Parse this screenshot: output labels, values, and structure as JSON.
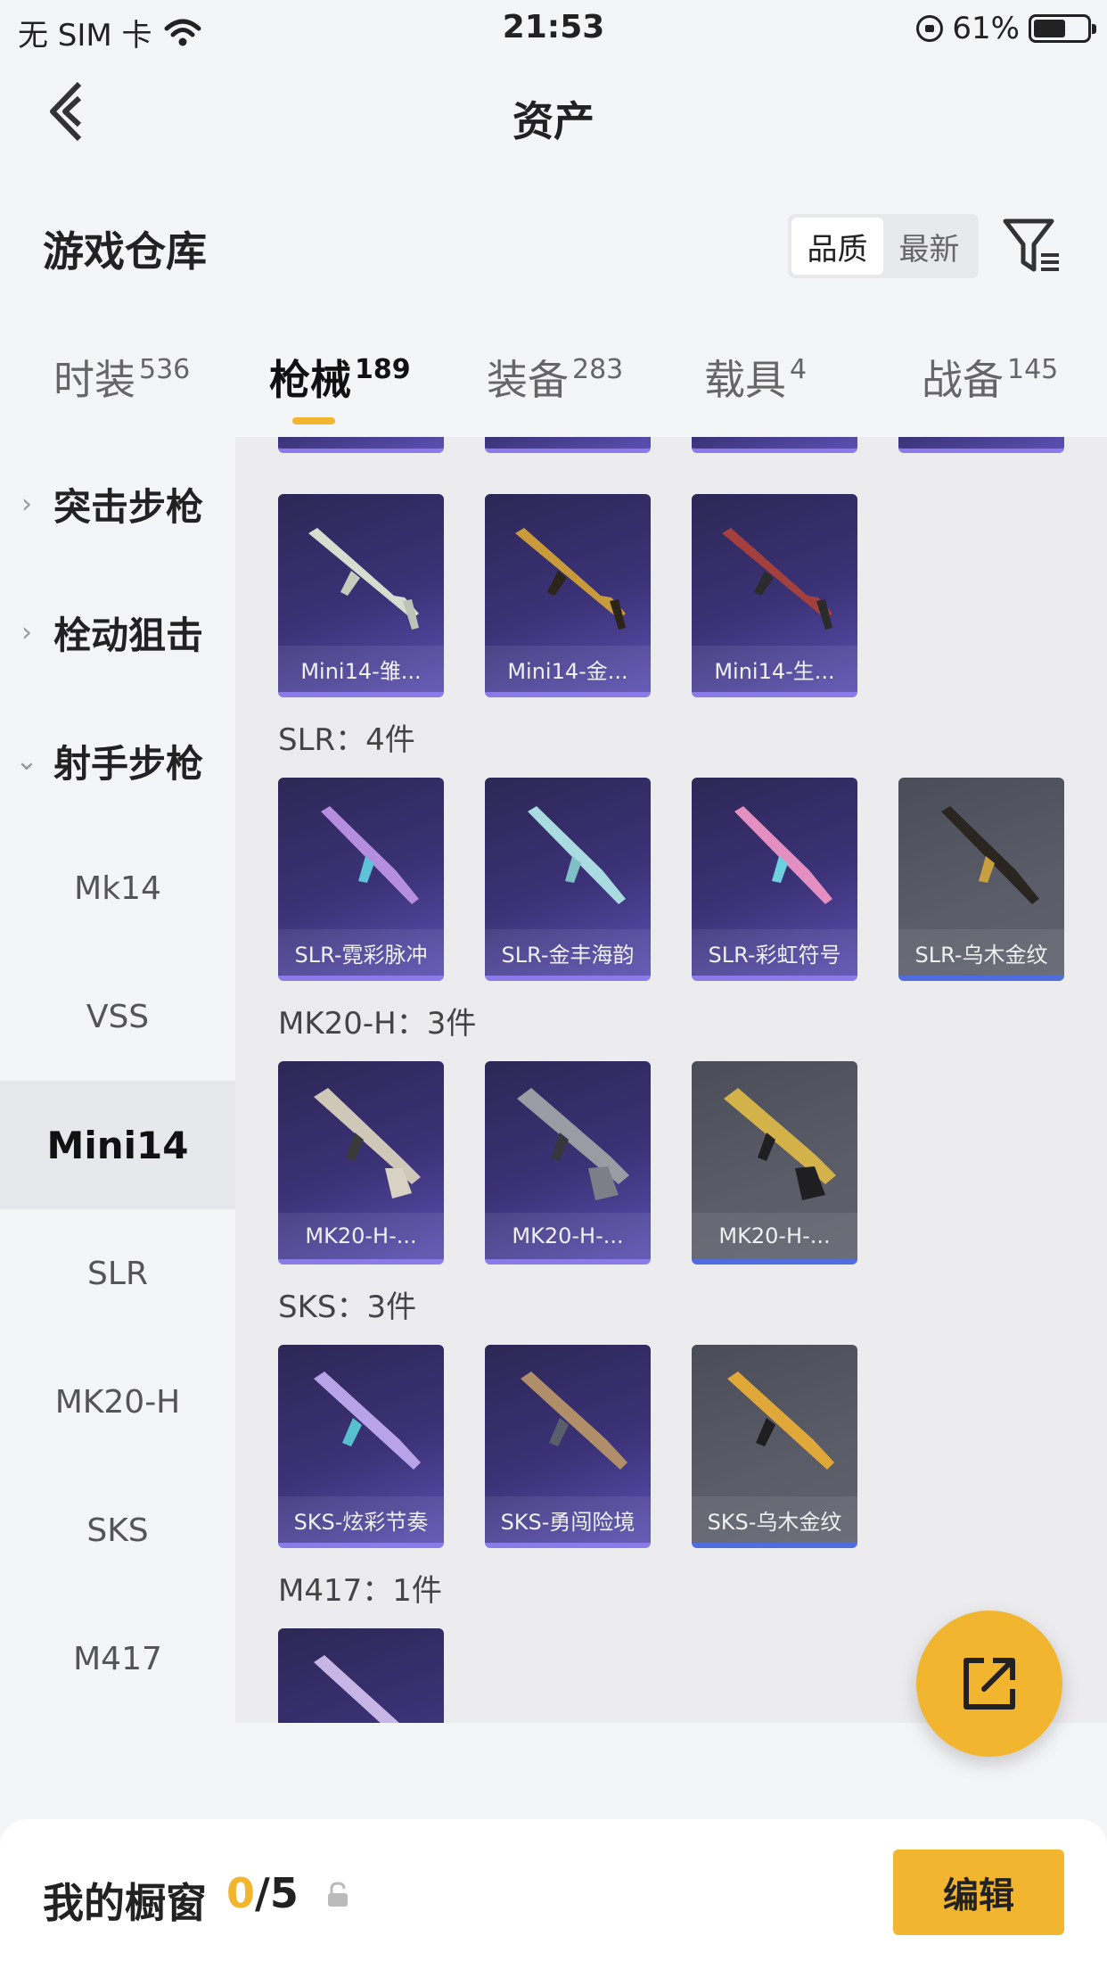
{
  "status_bar": {
    "carrier": "无 SIM 卡",
    "time": "21:53",
    "battery_percent": "61%",
    "battery_level": 0.61
  },
  "nav": {
    "title": "资产"
  },
  "warehouse": {
    "title": "游戏仓库",
    "sort_options": [
      "品质",
      "最新"
    ],
    "sort_active": "品质"
  },
  "category_tabs": [
    {
      "label": "时装",
      "count": "536"
    },
    {
      "label": "枪械",
      "count": "189",
      "active": true
    },
    {
      "label": "装备",
      "count": "283"
    },
    {
      "label": "载具",
      "count": "4"
    },
    {
      "label": "战备",
      "count": "145"
    }
  ],
  "sidebar": {
    "groups": [
      "突击步枪",
      "栓动狙击",
      "射手步枪"
    ],
    "items": [
      "Mk14",
      "VSS",
      "Mini14",
      "SLR",
      "MK20-H",
      "SKS",
      "M417"
    ],
    "active_item": "Mini14"
  },
  "sections": [
    {
      "label": "",
      "cards": [
        {
          "name": "Mini14-雏...",
          "rarity": "purple"
        },
        {
          "name": "Mini14-金...",
          "rarity": "purple"
        },
        {
          "name": "Mini14-生...",
          "rarity": "purple"
        }
      ]
    },
    {
      "label": "SLR：4件",
      "cards": [
        {
          "name": "SLR-霓彩脉冲",
          "rarity": "purple"
        },
        {
          "name": "SLR-金丰海韵",
          "rarity": "purple"
        },
        {
          "name": "SLR-彩虹符号",
          "rarity": "purple"
        },
        {
          "name": "SLR-乌木金纹",
          "rarity": "gray"
        }
      ]
    },
    {
      "label": "MK20-H：3件",
      "cards": [
        {
          "name": "MK20-H-...",
          "rarity": "purple"
        },
        {
          "name": "MK20-H-...",
          "rarity": "purple"
        },
        {
          "name": "MK20-H-...",
          "rarity": "gray"
        }
      ]
    },
    {
      "label": "SKS：3件",
      "cards": [
        {
          "name": "SKS-炫彩节奏",
          "rarity": "purple"
        },
        {
          "name": "SKS-勇闯险境",
          "rarity": "purple"
        },
        {
          "name": "SKS-乌木金纹",
          "rarity": "gray"
        }
      ]
    },
    {
      "label": "M417：1件",
      "cards": [
        {
          "name": "",
          "rarity": "purple"
        }
      ]
    }
  ],
  "bottom_bar": {
    "label": "我的橱窗",
    "current": "0",
    "total": "/5",
    "edit_label": "编辑"
  },
  "colors": {
    "accent": "#f2b530",
    "card_purple": "#3b3277",
    "card_gray": "#5a5c68"
  },
  "icons": [
    "back-chevron-icon",
    "filter-icon",
    "share-icon",
    "lock-icon",
    "wifi-icon",
    "rotation-lock-icon",
    "battery-icon"
  ]
}
